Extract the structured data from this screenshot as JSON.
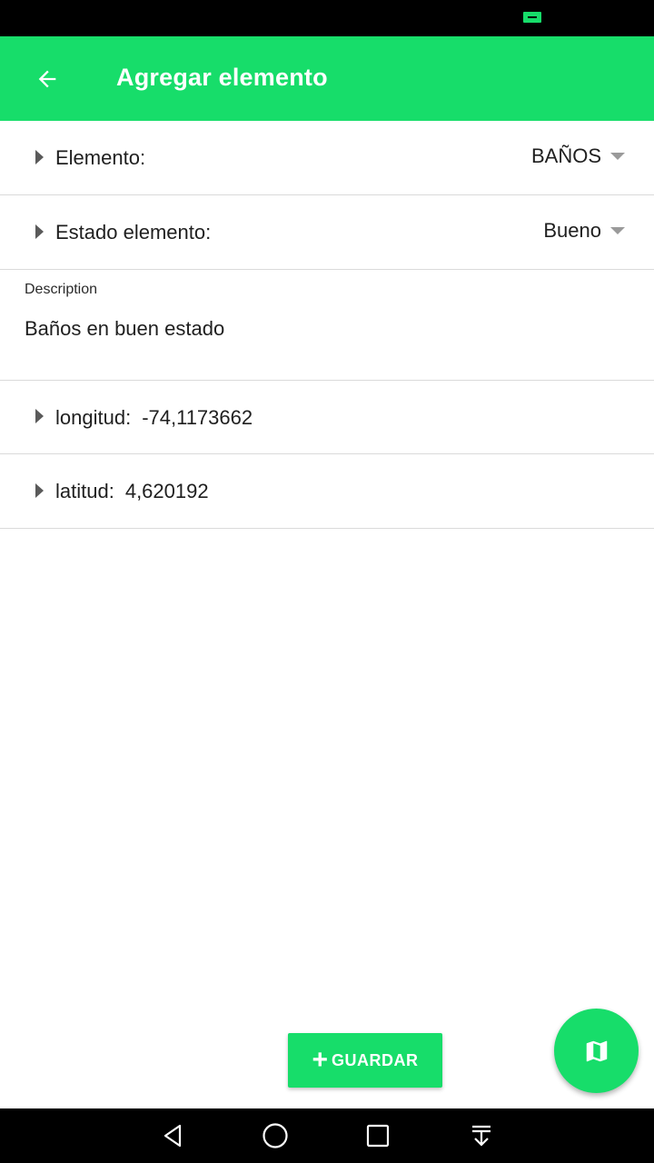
{
  "app_bar": {
    "title": "Agregar elemento",
    "background_color": "#17dd6a",
    "back_icon": "arrow-left-icon"
  },
  "form": {
    "elemento": {
      "label": "Elemento:",
      "selected": "BAÑOS"
    },
    "estado": {
      "label": "Estado elemento:",
      "selected": "Bueno"
    },
    "description": {
      "label": "Description",
      "value": "Baños en buen estado"
    },
    "longitud": {
      "label": "longitud:",
      "value": "-74,1173662"
    },
    "latitud": {
      "label": "latitud:",
      "value": "4,620192"
    }
  },
  "actions": {
    "save_label": "GUARDAR",
    "save_icon": "plus-icon",
    "fab_icon": "map-icon"
  },
  "system_nav": {
    "icons": [
      "back-triangle-icon",
      "home-circle-icon",
      "recents-square-icon",
      "notifications-pull-icon"
    ]
  }
}
